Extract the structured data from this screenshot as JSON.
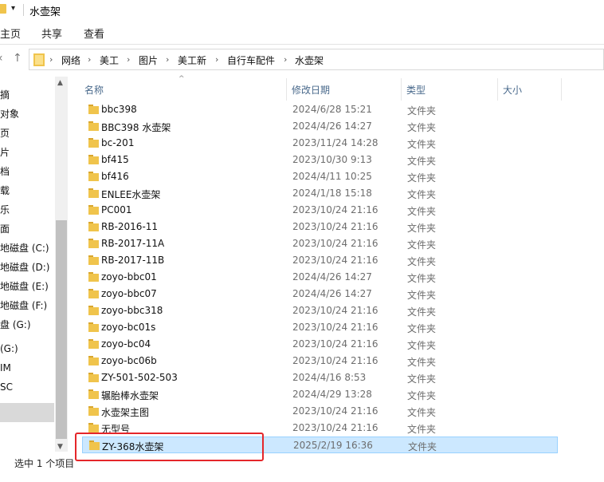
{
  "window": {
    "title": "水壶架",
    "quick_access": {
      "folder_icon": "folder-icon",
      "dropdown_icon": "chevron-down-icon",
      "dropdown_glyph": "▾"
    }
  },
  "ribbon": {
    "tabs": [
      "主页",
      "共享",
      "查看"
    ]
  },
  "navigation": {
    "back_glyph": "‹",
    "up_glyph": "↑"
  },
  "address": {
    "breadcrumbs": [
      "网络",
      "美工",
      "图片",
      "美工新",
      "自行车配件",
      "水壶架"
    ],
    "separator": "›"
  },
  "nav_pane": {
    "items": [
      "摘",
      "对象",
      "页",
      "片",
      "档",
      "载",
      "乐",
      "面",
      "地磁盘 (C:)",
      "地磁盘 (D:)",
      "地磁盘 (E:)",
      "地磁盘 (F:)",
      "盘 (G:)",
      "(G:)",
      "IM",
      "SC",
      ""
    ],
    "scroll_up": "▲",
    "scroll_down": "▼"
  },
  "columns": {
    "name": "名称",
    "date": "修改日期",
    "type": "类型",
    "size": "大小",
    "sort_caret": "^"
  },
  "files": [
    {
      "name": "bbc398",
      "date": "2024/6/28 15:21",
      "type": "文件夹"
    },
    {
      "name": "BBC398 水壶架",
      "date": "2024/4/26 14:27",
      "type": "文件夹"
    },
    {
      "name": "bc-201",
      "date": "2023/11/24 14:28",
      "type": "文件夹"
    },
    {
      "name": "bf415",
      "date": "2023/10/30 9:13",
      "type": "文件夹"
    },
    {
      "name": "bf416",
      "date": "2024/4/11 10:25",
      "type": "文件夹"
    },
    {
      "name": "ENLEE水壶架",
      "date": "2024/1/18 15:18",
      "type": "文件夹"
    },
    {
      "name": "PC001",
      "date": "2023/10/24 21:16",
      "type": "文件夹"
    },
    {
      "name": "RB-2016-11",
      "date": "2023/10/24 21:16",
      "type": "文件夹"
    },
    {
      "name": "RB-2017-11A",
      "date": "2023/10/24 21:16",
      "type": "文件夹"
    },
    {
      "name": "RB-2017-11B",
      "date": "2023/10/24 21:16",
      "type": "文件夹"
    },
    {
      "name": "zoyo-bbc01",
      "date": "2024/4/26 14:27",
      "type": "文件夹"
    },
    {
      "name": "zoyo-bbc07",
      "date": "2024/4/26 14:27",
      "type": "文件夹"
    },
    {
      "name": "zoyo-bbc318",
      "date": "2023/10/24 21:16",
      "type": "文件夹"
    },
    {
      "name": "zoyo-bc01s",
      "date": "2023/10/24 21:16",
      "type": "文件夹"
    },
    {
      "name": "zoyo-bc04",
      "date": "2023/10/24 21:16",
      "type": "文件夹"
    },
    {
      "name": "zoyo-bc06b",
      "date": "2023/10/24 21:16",
      "type": "文件夹"
    },
    {
      "name": "ZY-501-502-503",
      "date": "2024/4/16 8:53",
      "type": "文件夹"
    },
    {
      "name": "辗胎棒水壶架",
      "date": "2024/4/29 13:28",
      "type": "文件夹"
    },
    {
      "name": "水壶架主图",
      "date": "2023/10/24 21:16",
      "type": "文件夹"
    },
    {
      "name": "无型号",
      "date": "2023/10/24 21:16",
      "type": "文件夹"
    },
    {
      "name": "ZY-368水壶架",
      "date": "2025/2/19 16:36",
      "type": "文件夹",
      "selected": true
    }
  ],
  "status": {
    "text": "选中 1 个项目"
  },
  "colors": {
    "folder": "#f0c44c",
    "folder_dark": "#d9a62e",
    "selected_row": "#cce8ff",
    "highlight": "#e5262a",
    "header_text": "#4a6a8c"
  }
}
